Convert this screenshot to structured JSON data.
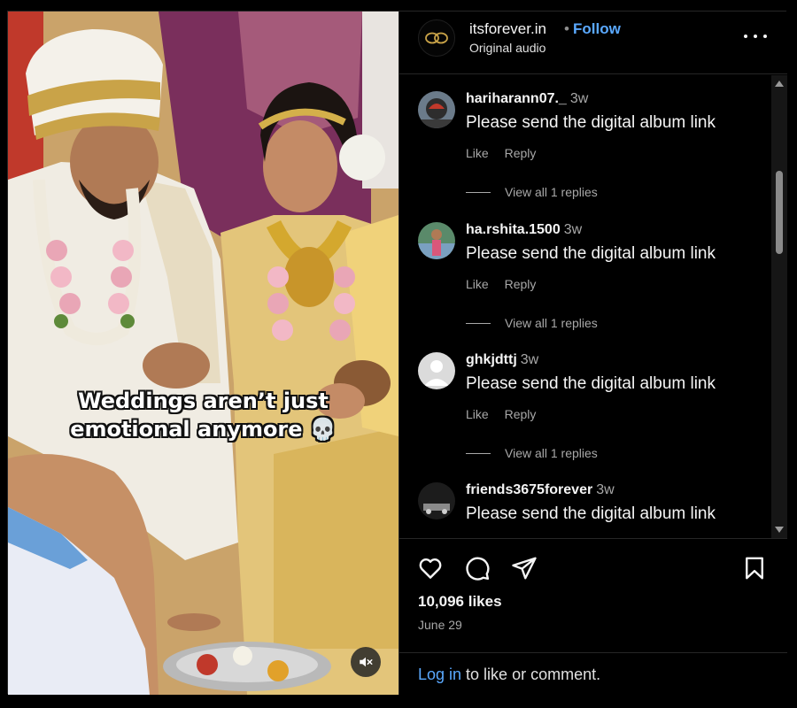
{
  "video": {
    "caption_line1": "Weddings aren’t just",
    "caption_line2": "emotional anymore 💀",
    "mute_icon": "speaker-muted-icon"
  },
  "header": {
    "username": "itsforever.in",
    "separator": "•",
    "follow_label": "Follow",
    "audio_label": "Original audio",
    "more_icon": "more-options-icon"
  },
  "comments": [
    {
      "user": "hariharann07._",
      "time": "3w",
      "text": "Please send the digital album link",
      "like": "Like",
      "reply": "Reply",
      "replies": "View all 1 replies"
    },
    {
      "user": "ha.rshita.1500",
      "time": "3w",
      "text": "Please send the digital album link",
      "like": "Like",
      "reply": "Reply",
      "replies": "View all 1 replies"
    },
    {
      "user": "ghkjdttj",
      "time": "3w",
      "text": "Please send the digital album link",
      "like": "Like",
      "reply": "Reply",
      "replies": "View all 1 replies"
    },
    {
      "user": "friends3675forever",
      "time": "3w",
      "text": "Please send the digital album link"
    }
  ],
  "actions": {
    "like_icon": "heart-icon",
    "comment_icon": "comment-icon",
    "share_icon": "share-icon",
    "save_icon": "bookmark-icon"
  },
  "stats": {
    "likes": "10,096 likes",
    "date": "June 29"
  },
  "login": {
    "link": "Log in",
    "rest": " to like or comment."
  },
  "colors": {
    "accent": "#5aa9ff",
    "background": "#000000",
    "muted_text": "#a8a8a8"
  }
}
